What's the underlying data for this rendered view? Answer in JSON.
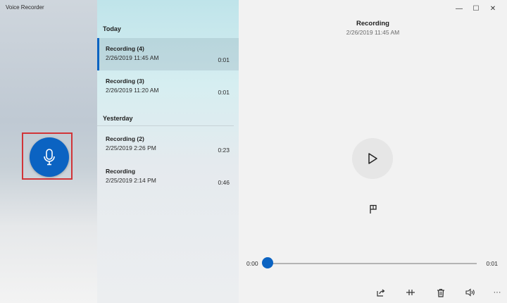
{
  "app": {
    "title": "Voice Recorder"
  },
  "groups": [
    {
      "label": "Today"
    },
    {
      "label": "Yesterday"
    }
  ],
  "recordings": [
    {
      "name": "Recording (4)",
      "date": "2/26/2019 11:45 AM",
      "duration": "0:01",
      "selected": true
    },
    {
      "name": "Recording (3)",
      "date": "2/26/2019 11:20 AM",
      "duration": "0:01"
    },
    {
      "name": "Recording (2)",
      "date": "2/25/2019 2:26 PM",
      "duration": "0:23"
    },
    {
      "name": "Recording",
      "date": "2/25/2019 2:14 PM",
      "duration": "0:46"
    }
  ],
  "player": {
    "title": "Recording",
    "date": "2/26/2019 11:45 AM",
    "time_start": "0:00",
    "time_end": "0:01",
    "progress": 0
  },
  "window_controls": {
    "minimize": "—",
    "maximize": "☐",
    "close": "✕"
  },
  "toolbar": {
    "more": "···"
  },
  "icons": {
    "record": "microphone-icon",
    "play": "play-icon",
    "marker": "flag-icon",
    "share": "share-icon",
    "trim": "trim-icon",
    "delete": "trash-icon",
    "speaker": "speaker-icon"
  },
  "colors": {
    "accent": "#0b63c2",
    "highlight_border": "#d13438"
  }
}
